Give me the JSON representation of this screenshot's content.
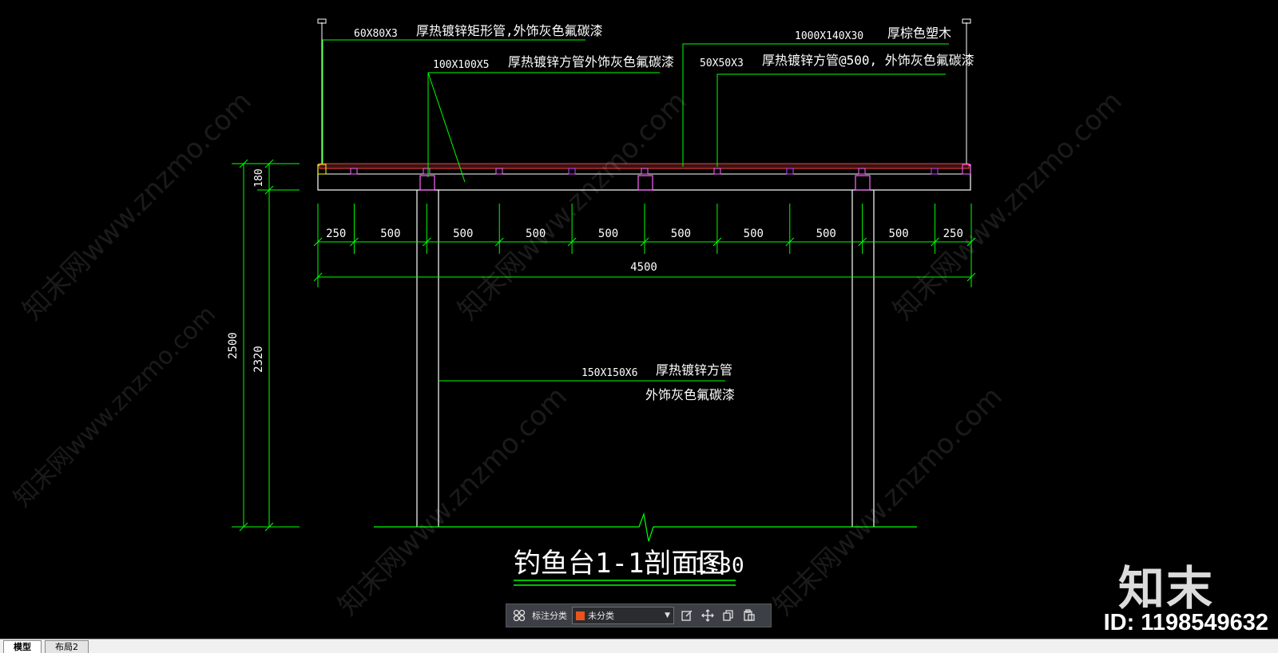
{
  "drawing": {
    "callouts": {
      "c1_size": "60X80X3",
      "c1_desc": "厚热镀锌矩形管,外饰灰色氟碳漆",
      "c2_size": "100X100X5",
      "c2_desc": "厚热镀锌方管外饰灰色氟碳漆",
      "c3_size": "1000X140X30",
      "c3_desc": "厚棕色塑木",
      "c4_size": "50X50X3",
      "c4_desc": "厚热镀锌方管@500, 外饰灰色氟碳漆",
      "c5_size": "150X150X6",
      "c5_desc1": "厚热镀锌方管",
      "c5_desc2": "外饰灰色氟碳漆"
    },
    "dims": {
      "h_segments": [
        "250",
        "500",
        "500",
        "500",
        "500",
        "500",
        "500",
        "500",
        "500",
        "250"
      ],
      "h_total": "4500",
      "v_total": "2500",
      "v_deck": "180",
      "v_post": "2320"
    },
    "title": "钓鱼台1-1剖面图",
    "scale": "1:30"
  },
  "watermark": {
    "text": "知末网www.znzmo.com",
    "brand": "知末",
    "id": "ID: 1198549632"
  },
  "toolbar": {
    "label": "标注分类",
    "category_value": "未分类",
    "category_color": "#e8541c"
  },
  "tabs": [
    {
      "label": "模型",
      "active": true
    },
    {
      "label": "布局2",
      "active": false
    }
  ]
}
